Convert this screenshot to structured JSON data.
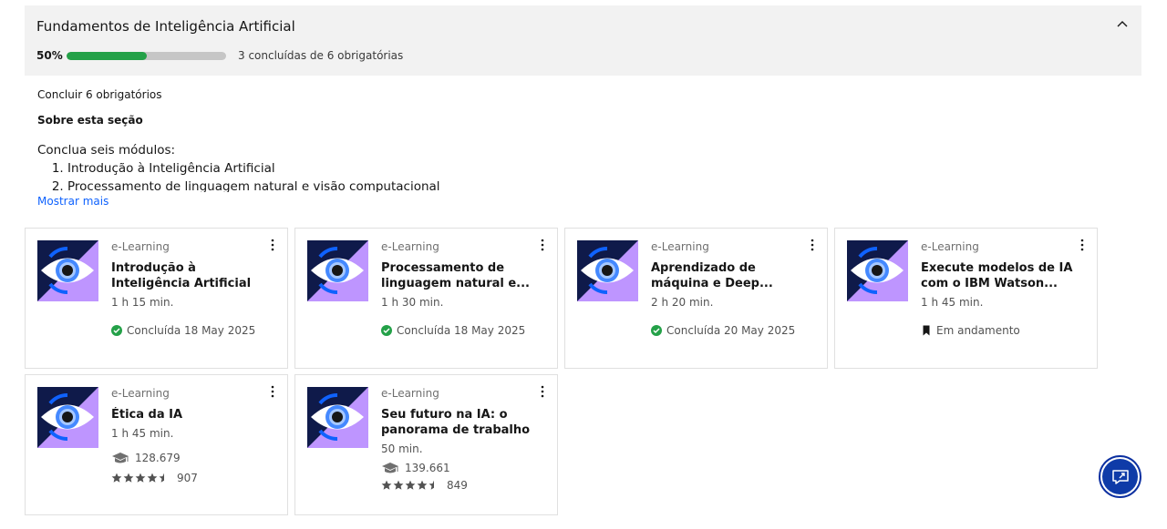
{
  "section": {
    "title": "Fundamentos de Inteligência Artificial",
    "progress_pct_label": "50%",
    "progress_fraction": 0.5,
    "progress_text": "3 concluídas de 6 obrigatórias",
    "required_text": "Concluir 6 obrigatórios",
    "about_title": "Sobre esta seção",
    "about_intro": "Conclua seis módulos:",
    "about_items": [
      "Introdução à Inteligência Artificial",
      "Processamento de linguagem natural e visão computacional"
    ],
    "show_more": "Mostrar mais"
  },
  "cards": [
    {
      "type": "e-Learning",
      "title": "Introdução à Inteligência Artificial",
      "duration": "1 h 15 min.",
      "status": "Concluída 18 May 2025",
      "status_kind": "done"
    },
    {
      "type": "e-Learning",
      "title": "Processamento de linguagem natural e...",
      "duration": "1 h 30 min.",
      "status": "Concluída 18 May 2025",
      "status_kind": "done"
    },
    {
      "type": "e-Learning",
      "title": "Aprendizado de máquina e Deep...",
      "duration": "2 h 20 min.",
      "status": "Concluída 20 May 2025",
      "status_kind": "done"
    },
    {
      "type": "e-Learning",
      "title": "Execute modelos de IA com o IBM Watson...",
      "duration": "1 h 45 min.",
      "status": "Em andamento",
      "status_kind": "in-progress"
    },
    {
      "type": "e-Learning",
      "title": "Ética da IA",
      "duration": "1 h 45 min.",
      "learners": "128.679",
      "rating_count": "907",
      "rating": 4.5
    },
    {
      "type": "e-Learning",
      "title": "Seu futuro na IA: o panorama de trabalho",
      "duration": "50 min.",
      "learners": "139.661",
      "rating_count": "849",
      "rating": 4.5
    }
  ],
  "colors": {
    "progress": "#24a148",
    "link": "#0f62fe",
    "fab": "#0f3ba8"
  }
}
